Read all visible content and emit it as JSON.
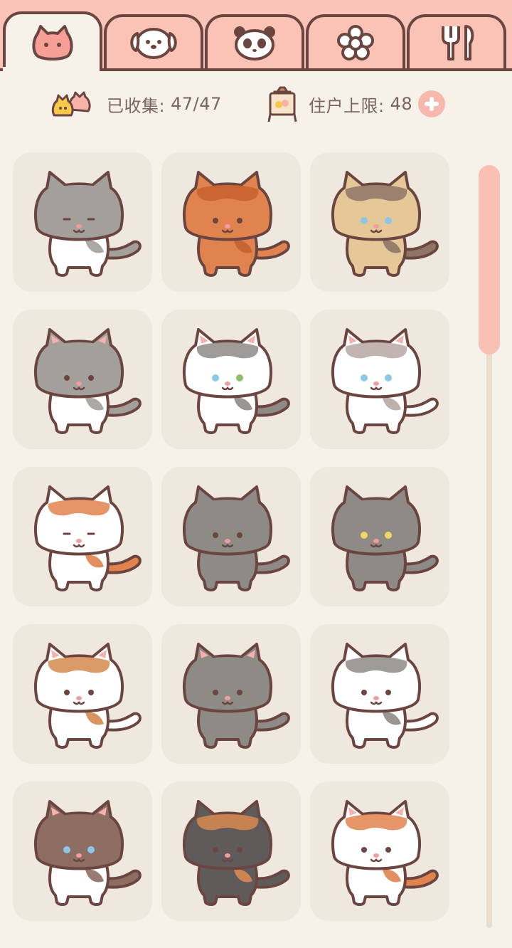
{
  "tabs": [
    {
      "name": "cats",
      "icon": "cat-face-icon",
      "active": true
    },
    {
      "name": "dogs",
      "icon": "dog-face-icon",
      "active": false
    },
    {
      "name": "pandas",
      "icon": "panda-face-icon",
      "active": false
    },
    {
      "name": "flowers",
      "icon": "flower-icon",
      "active": false
    },
    {
      "name": "food",
      "icon": "fork-spoon-icon",
      "active": false
    }
  ],
  "stats": {
    "collected_label": "已收集:",
    "collected_value": "47/47",
    "capacity_label": "住户上限:",
    "capacity_value": "48"
  },
  "cats": [
    {
      "id": "grey-white",
      "head": "#a39f9b",
      "body": "#ffffff",
      "patch": "#a39f9b",
      "tail": "#a39f9b",
      "eyes": "sleepy",
      "ears_pink": false
    },
    {
      "id": "orange",
      "head": "#e0834e",
      "body": "#e0834e",
      "patch": "#c7622f",
      "tail": "#e0834e",
      "eyes": "dot",
      "ears_pink": false
    },
    {
      "id": "siamese",
      "head": "#e6c898",
      "body": "#e6c898",
      "patch": "#8e7566",
      "tail": "#8e7566",
      "eyes": "blue",
      "ears_pink": false
    },
    {
      "id": "grey-tabby-white",
      "head": "#a39f9b",
      "body": "#ffffff",
      "patch": "#a39f9b",
      "tail": "#a39f9b",
      "eyes": "dot",
      "ears_pink": true
    },
    {
      "id": "white-grey-cap",
      "head": "#ffffff",
      "body": "#ffffff",
      "patch": "#8e8a86",
      "tail": "#8e8a86",
      "eyes": "odd",
      "ears_pink": true
    },
    {
      "id": "ragdoll",
      "head": "#ffffff",
      "body": "#ffffff",
      "patch": "#b7a7a2",
      "tail": "#ffffff",
      "eyes": "blue",
      "ears_pink": true
    },
    {
      "id": "orange-white-grumpy",
      "head": "#ffffff",
      "body": "#ffffff",
      "patch": "#e0834e",
      "tail": "#e0834e",
      "eyes": "sleepy",
      "ears_pink": false
    },
    {
      "id": "grey-muzzle",
      "head": "#8e8a86",
      "body": "#8e8a86",
      "patch": "#8e8a86",
      "tail": "#8e8a86",
      "eyes": "dot",
      "ears_pink": false
    },
    {
      "id": "grey-yellow-eyes",
      "head": "#8e8a86",
      "body": "#8e8a86",
      "patch": "#8e8a86",
      "tail": "#8e8a86",
      "eyes": "yellow",
      "ears_pink": false
    },
    {
      "id": "calico-spot",
      "head": "#ffffff",
      "body": "#ffffff",
      "patch": "#d58a4e",
      "tail": "#ffffff",
      "eyes": "dot",
      "ears_pink": true
    },
    {
      "id": "grey-tabby",
      "head": "#8e8a86",
      "body": "#8e8a86",
      "patch": "#8e8a86",
      "tail": "#8e8a86",
      "eyes": "dot",
      "ears_pink": true
    },
    {
      "id": "white-grey-spots",
      "head": "#ffffff",
      "body": "#ffffff",
      "patch": "#8e8a86",
      "tail": "#ffffff",
      "eyes": "dot",
      "ears_pink": false
    },
    {
      "id": "brown-white",
      "head": "#8e6d63",
      "body": "#ffffff",
      "patch": "#8e6d63",
      "tail": "#8e6d63",
      "eyes": "blue",
      "ears_pink": true
    },
    {
      "id": "tortie",
      "head": "#5f5b5b",
      "body": "#5f5b5b",
      "patch": "#d8894f",
      "tail": "#5f5b5b",
      "eyes": "dot",
      "ears_pink": false
    },
    {
      "id": "orange-white-tabby",
      "head": "#ffffff",
      "body": "#ffffff",
      "patch": "#e0834e",
      "tail": "#e0834e",
      "eyes": "dot",
      "ears_pink": true
    }
  ],
  "colors": {
    "accent_pink": "#fbc4b8",
    "outline": "#6b4640",
    "background": "#f6f2ea",
    "card": "#efe8de",
    "text": "#7b6560"
  }
}
